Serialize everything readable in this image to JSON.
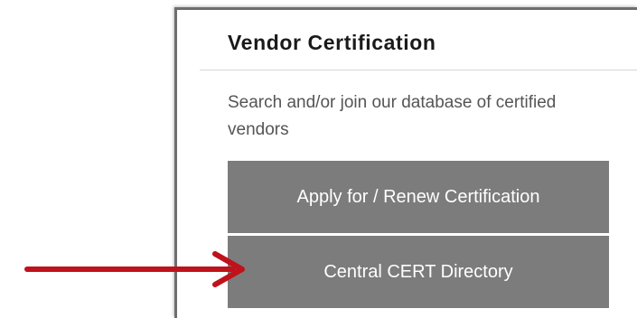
{
  "vendor_panel": {
    "title": "Vendor Certification",
    "description": "Search and/or join our database of certified vendors",
    "buttons": [
      {
        "label": "Apply for / Renew Certification"
      },
      {
        "label": "Central CERT Directory"
      }
    ]
  },
  "annotation": {
    "icon": "arrow-right-icon",
    "color": "#c0121b",
    "points_to": "Central CERT Directory"
  },
  "colors": {
    "button_bg": "#7c7c7c",
    "button_text": "#ffffff",
    "title_text": "#1a1a1a",
    "description_text": "#555555",
    "panel_border": "#6e6e6e"
  }
}
